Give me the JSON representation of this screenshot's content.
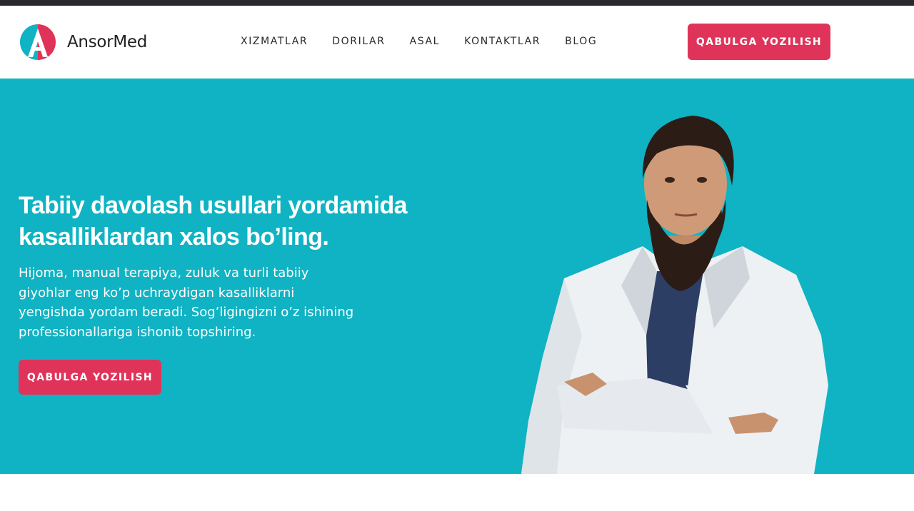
{
  "brand": {
    "name": "AnsorMed",
    "logo_icon": "ansormed-logo-icon",
    "colors": {
      "accent": "#e0335a",
      "teal": "#10b3c3",
      "dark": "#2a2a2e"
    }
  },
  "nav": {
    "items": [
      {
        "label": "XIZMATLAR"
      },
      {
        "label": "DORILAR"
      },
      {
        "label": "ASAL"
      },
      {
        "label": "KONTAKTLAR"
      },
      {
        "label": "BLOG"
      }
    ]
  },
  "header": {
    "cta_label": "QABULGA YOZILISH"
  },
  "hero": {
    "title_line1": "Tabiiy davolash usullari yordamida",
    "title_line2": "kasalliklardan xalos bo’ling.",
    "description": "Hijoma, manual terapiya, zuluk va turli tabiiy giyohlar eng ko’p uchraydigan kasalliklarni yengishda yordam beradi. Sog’ligingizni o’z ishining professionallariga ishonib topshiring.",
    "cta_label": "QABULGA YOZILISH",
    "image": "doctor-portrait"
  }
}
